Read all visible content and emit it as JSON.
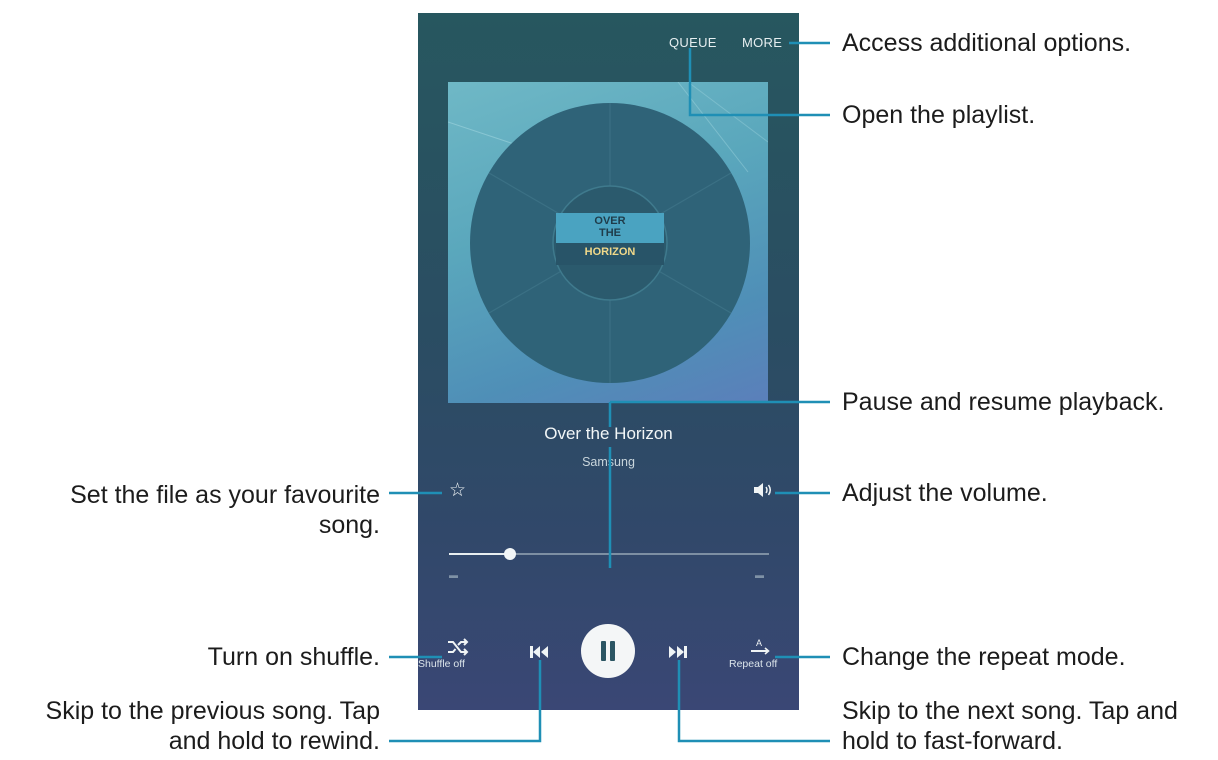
{
  "player": {
    "queue_label": "QUEUE",
    "more_label": "MORE",
    "album_art_text": {
      "line1": "OVER",
      "line2": "THE",
      "line3": "HORIZON"
    },
    "song_title": "Over the Horizon",
    "artist": "Samsung",
    "progress_fraction": 0.19,
    "shuffle_label": "Shuffle off",
    "repeat_label": "Repeat off"
  },
  "annotations": {
    "more": "Access additional options.",
    "queue": "Open the playlist.",
    "pause": "Pause and resume playback.",
    "favourite_line1": "Set the file as your favourite",
    "favourite_line2": "song.",
    "volume": "Adjust the volume.",
    "shuffle": "Turn on shuffle.",
    "repeat": "Change the repeat mode.",
    "previous_line1": "Skip to the previous song. Tap",
    "previous_line2": "and hold to rewind.",
    "next_line1": "Skip to the next song. Tap and",
    "next_line2": "hold to fast-forward."
  },
  "colors": {
    "callout_line": "#1f8fb5",
    "player_bg": "#2a4d62"
  },
  "icons": [
    "star-icon",
    "volume-icon",
    "shuffle-icon",
    "previous-icon",
    "pause-icon",
    "next-icon",
    "repeat-icon"
  ]
}
